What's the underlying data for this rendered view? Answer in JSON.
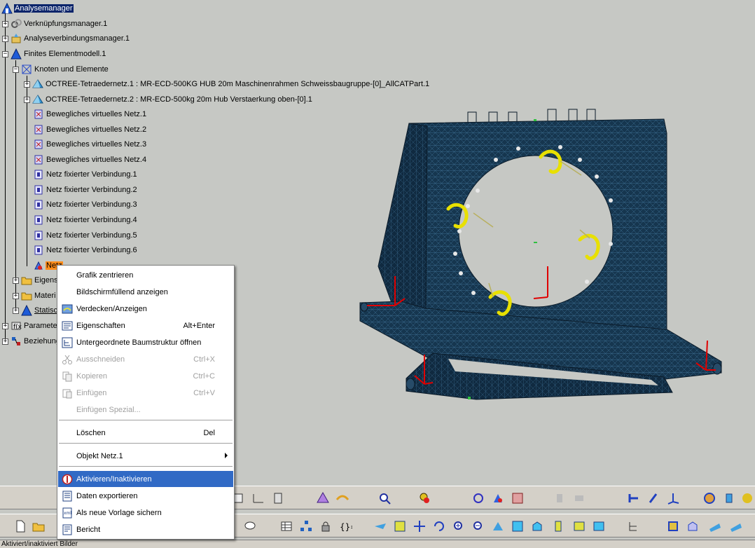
{
  "tree": {
    "root": "Analysemanager",
    "nodes": [
      {
        "label": "Verknüpfungsmanager.1"
      },
      {
        "label": "Analyseverbindungsmanager.1"
      },
      {
        "label": "Finites Elementmodell.1"
      },
      {
        "label": "Knoten und Elemente"
      },
      {
        "label": "OCTREE-Tetraedernetz.1 : MR-ECD-500KG HUB 20m Maschinenrahmen Schweissbaugruppe-[0]_AllCATPart.1"
      },
      {
        "label": "OCTREE-Tetraedernetz.2 : MR-ECD-500kg 20m Hub Verstaerkung oben-[0].1"
      },
      {
        "label": "Bewegliches virtuelles Netz.1"
      },
      {
        "label": "Bewegliches virtuelles Netz.2"
      },
      {
        "label": "Bewegliches virtuelles Netz.3"
      },
      {
        "label": "Bewegliches virtuelles Netz.4"
      },
      {
        "label": "Netz fixierter Verbindung.1"
      },
      {
        "label": "Netz fixierter Verbindung.2"
      },
      {
        "label": "Netz fixierter Verbindung.3"
      },
      {
        "label": "Netz fixierter Verbindung.4"
      },
      {
        "label": "Netz fixierter Verbindung.5"
      },
      {
        "label": "Netz fixierter Verbindung.6"
      },
      {
        "label": "Netz"
      },
      {
        "label": "Eigens"
      },
      {
        "label": "Materi"
      },
      {
        "label": "Statisc"
      },
      {
        "label": "Paramete"
      },
      {
        "label": "Beziehung"
      }
    ]
  },
  "context_menu": {
    "items": [
      {
        "label": "Grafik zentrieren",
        "shortcut": "",
        "disabled": false
      },
      {
        "label": "Bildschirmfüllend anzeigen",
        "shortcut": "",
        "disabled": false
      },
      {
        "label": "Verdecken/Anzeigen",
        "shortcut": "",
        "disabled": false
      },
      {
        "label": "Eigenschaften",
        "shortcut": "Alt+Enter",
        "disabled": false
      },
      {
        "label": "Untergeordnete Baumstruktur öffnen",
        "shortcut": "",
        "disabled": false
      },
      {
        "label": "Ausschneiden",
        "shortcut": "Ctrl+X",
        "disabled": true
      },
      {
        "label": "Kopieren",
        "shortcut": "Ctrl+C",
        "disabled": true
      },
      {
        "label": "Einfügen",
        "shortcut": "Ctrl+V",
        "disabled": true
      },
      {
        "label": "Einfügen Spezial...",
        "shortcut": "",
        "disabled": true
      },
      {
        "label": "Löschen",
        "shortcut": "Del",
        "disabled": false
      },
      {
        "label": "Objekt Netz.1",
        "shortcut": "",
        "disabled": false
      },
      {
        "label": "Aktivieren/Inaktivieren",
        "shortcut": "",
        "disabled": false
      },
      {
        "label": "Daten exportieren",
        "shortcut": "",
        "disabled": false
      },
      {
        "label": "Als neue Vorlage sichern",
        "shortcut": "",
        "disabled": false
      },
      {
        "label": "Bericht",
        "shortcut": "",
        "disabled": false
      }
    ]
  },
  "statusbar": {
    "text": "Aktiviert/inaktiviert Bilder"
  },
  "colors": {
    "background": "#c6c8c4",
    "mesh": "#1a3a56",
    "restraint": "#e8e000",
    "load_arrow": "#e00000",
    "menu_highlight": "#316ac5",
    "tree_selection": "#0a246a",
    "tree_highlight": "#ff8c1a"
  },
  "icons": {
    "root": "analysis-manager-icon",
    "mesh": "mesh-icon",
    "toolbar": [
      "mesh-icon",
      "sensor-icon",
      "zoom-icon",
      "gear-icon",
      "refresh-icon",
      "drill-icon",
      "fit-icon"
    ]
  }
}
